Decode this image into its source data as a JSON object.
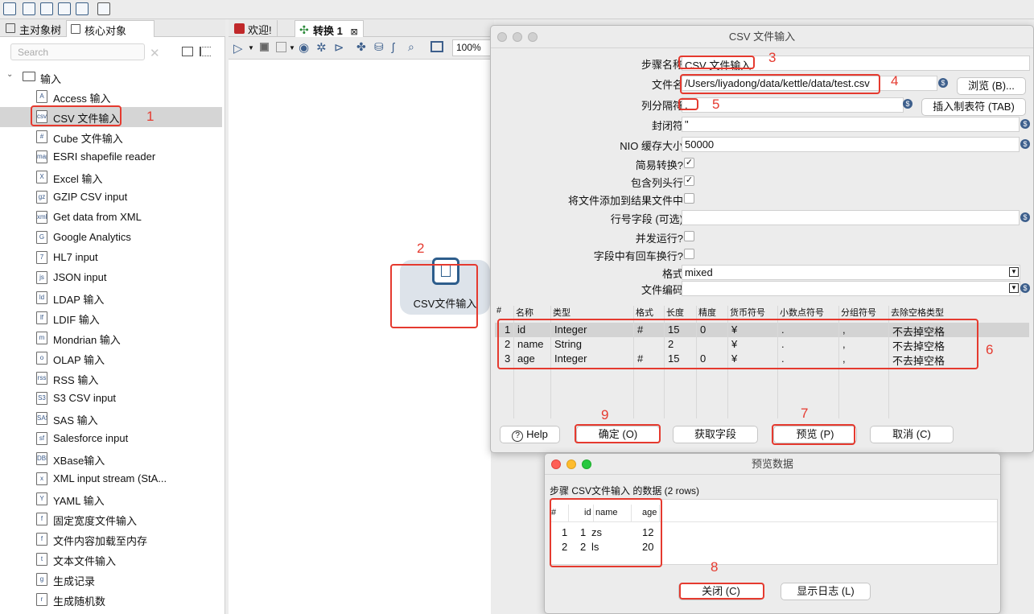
{
  "left_tabs": [
    "主对象树",
    "核心对象"
  ],
  "search": {
    "placeholder": "Search"
  },
  "tree_root": "输入",
  "tree_items": [
    {
      "label": "Access 输入",
      "icon": "A"
    },
    {
      "label": "CSV 文件输入",
      "icon": "csv"
    },
    {
      "label": "Cube 文件输入",
      "icon": "#"
    },
    {
      "label": "ESRI shapefile reader",
      "icon": "map"
    },
    {
      "label": "Excel 输入",
      "icon": "X"
    },
    {
      "label": "GZIP CSV input",
      "icon": "gz"
    },
    {
      "label": "Get data from XML",
      "icon": "xml"
    },
    {
      "label": "Google Analytics",
      "icon": "G"
    },
    {
      "label": "HL7 input",
      "icon": "7"
    },
    {
      "label": "JSON input",
      "icon": "js"
    },
    {
      "label": "LDAP 输入",
      "icon": "ld"
    },
    {
      "label": "LDIF 输入",
      "icon": "lf"
    },
    {
      "label": "Mondrian 输入",
      "icon": "m"
    },
    {
      "label": "OLAP 输入",
      "icon": "o"
    },
    {
      "label": "RSS 输入",
      "icon": "rss"
    },
    {
      "label": "S3 CSV input",
      "icon": "S3"
    },
    {
      "label": "SAS 输入",
      "icon": "SAS"
    },
    {
      "label": "Salesforce input",
      "icon": "sf"
    },
    {
      "label": "XBase输入",
      "icon": "DBF"
    },
    {
      "label": "XML input stream (StA...",
      "icon": "x"
    },
    {
      "label": "YAML 输入",
      "icon": "Y"
    },
    {
      "label": "固定宽度文件输入",
      "icon": "f"
    },
    {
      "label": "文件内容加载至内存",
      "icon": "f"
    },
    {
      "label": "文本文件输入",
      "icon": "t"
    },
    {
      "label": "生成记录",
      "icon": "g"
    },
    {
      "label": "生成随机数",
      "icon": "r"
    }
  ],
  "canvas_tabs": [
    "欢迎!",
    "转换 1"
  ],
  "zoom": "100%",
  "canvas_step_label": "CSV文件输入",
  "dialog": {
    "title": "CSV 文件输入",
    "fields": {
      "step_name_label": "步骤名称",
      "step_name_value": "CSV 文件输入",
      "filename_label": "文件名",
      "filename_value": "/Users/liyadong/data/kettle/data/test.csv",
      "browse_btn": "浏览 (B)...",
      "delimiter_label": "列分隔符",
      "delimiter_value": ",",
      "insert_tab_btn": "插入制表符 (TAB)",
      "enclosure_label": "封闭符",
      "enclosure_value": "\"",
      "nio_label": "NIO 缓存大小",
      "nio_value": "50000",
      "lazy_label": "简易转换?",
      "header_label": "包含列头行",
      "add_file_label": "将文件添加到结果文件中",
      "rownum_label": "行号字段 (可选)",
      "parallel_label": "并发运行?",
      "newline_label": "字段中有回车换行?",
      "format_label": "格式",
      "format_value": "mixed",
      "encoding_label": "文件编码"
    },
    "checks": {
      "lazy": true,
      "header": true,
      "add_file": false,
      "parallel": false,
      "newline": false
    },
    "table_headers": [
      "#",
      "名称",
      "类型",
      "格式",
      "长度",
      "精度",
      "货币符号",
      "小数点符号",
      "分组符号",
      "去除空格类型"
    ],
    "table_rows": [
      [
        "1",
        "id",
        "Integer",
        "#",
        "15",
        "0",
        "¥",
        ".",
        ",",
        "不去掉空格"
      ],
      [
        "2",
        "name",
        "String",
        "",
        "2",
        "",
        "¥",
        ".",
        ",",
        "不去掉空格"
      ],
      [
        "3",
        "age",
        "Integer",
        "#",
        "15",
        "0",
        "¥",
        ".",
        ",",
        "不去掉空格"
      ]
    ],
    "buttons": {
      "help": "Help",
      "ok": "确定 (O)",
      "get_fields": "获取字段",
      "preview": "预览 (P)",
      "cancel": "取消 (C)"
    }
  },
  "preview": {
    "title": "预览数据",
    "caption": "步骤 CSV文件输入 的数据 (2 rows)",
    "headers": [
      "#",
      "id",
      "name",
      "age"
    ],
    "rows": [
      [
        "1",
        "1",
        "zs",
        "12"
      ],
      [
        "2",
        "2",
        "ls",
        "20"
      ]
    ],
    "close_btn": "关闭 (C)",
    "log_btn": "显示日志 (L)"
  },
  "annotations": [
    "1",
    "2",
    "3",
    "4",
    "5",
    "6",
    "7",
    "8",
    "9"
  ],
  "colors": {
    "annotation_red": "#e53a2f",
    "icon_blue": "#3d5f8c"
  }
}
